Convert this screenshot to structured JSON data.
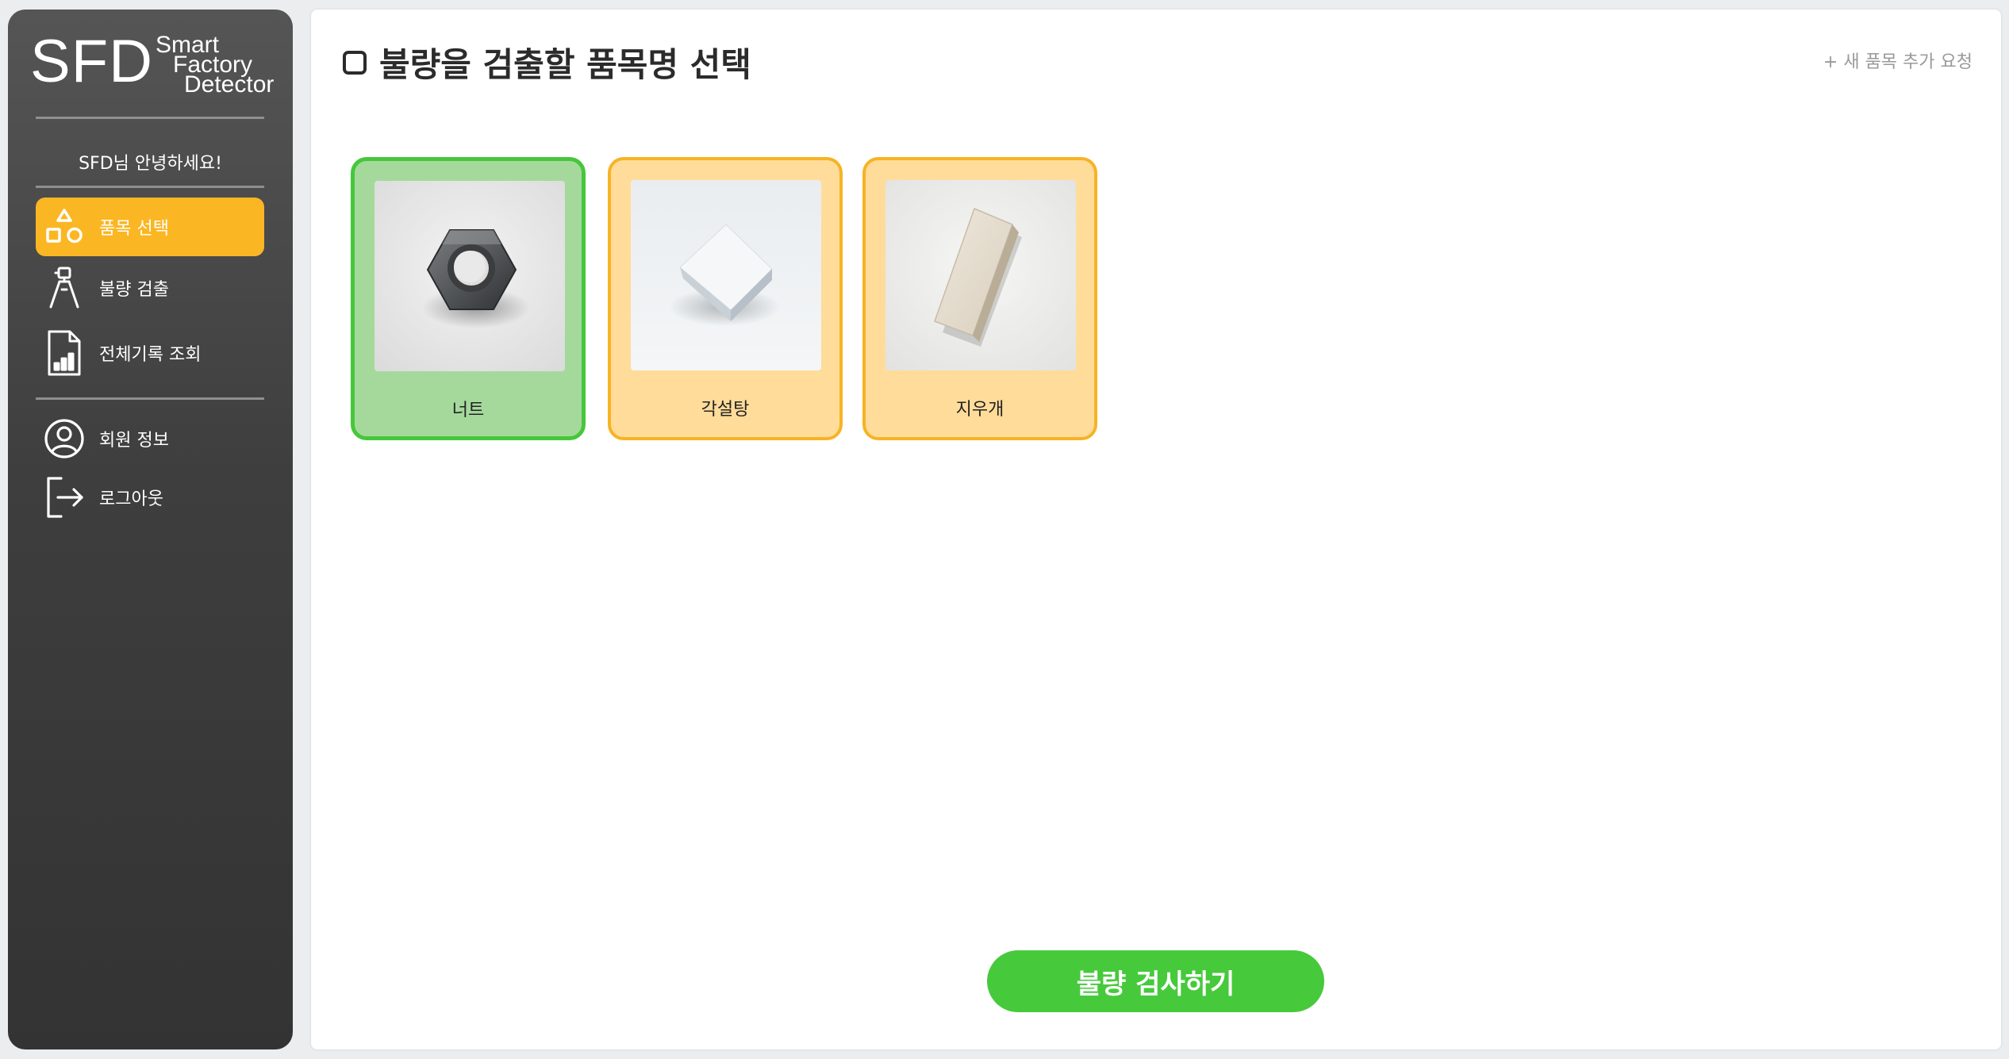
{
  "brand": {
    "logo_main": "SFD",
    "logo_sub_1": "Smart",
    "logo_sub_2": "Factory",
    "logo_sub_3": "Detector"
  },
  "sidebar": {
    "greeting": "SFD님 안녕하세요!",
    "items": [
      {
        "label": "품목 선택",
        "icon": "shapes-icon",
        "active": true
      },
      {
        "label": "불량 검출",
        "icon": "robot-arm-icon",
        "active": false
      },
      {
        "label": "전체기록 조회",
        "icon": "report-chart-icon",
        "active": false
      },
      {
        "label": "회원 정보",
        "icon": "user-circle-icon",
        "active": false
      },
      {
        "label": "로그아웃",
        "icon": "logout-icon",
        "active": false
      }
    ]
  },
  "main": {
    "title": "불량을 검출할 품목명 선택",
    "request_link": "+ 새 품목 추가 요청",
    "items": [
      {
        "name": "너트",
        "image": "hex-nut",
        "selected": true
      },
      {
        "name": "각설탕",
        "image": "sugar-cube",
        "selected": false
      },
      {
        "name": "지우개",
        "image": "eraser",
        "selected": false
      }
    ],
    "inspect_button": "불량 검사하기"
  },
  "colors": {
    "accent": "#fbb623",
    "selected_border": "#46c73b",
    "selected_bg": "#a5d99c",
    "card_bg": "#ffdc9a",
    "button": "#47c93c",
    "sidebar_dark": "#333333"
  }
}
